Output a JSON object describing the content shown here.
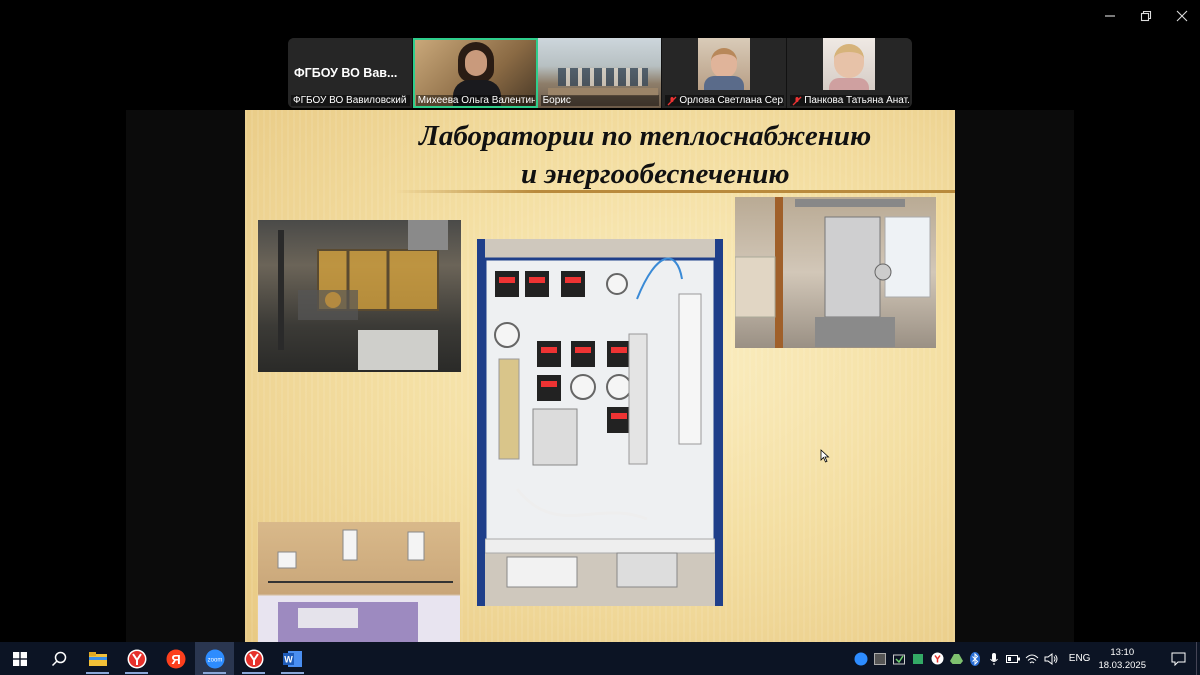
{
  "participants": [
    {
      "big_name": "ФГБОУ ВО Вав...",
      "label": "ФГБОУ ВО Вавиловский ...",
      "muted": false,
      "active": false
    },
    {
      "label": "Михеева Ольга Валентин...",
      "muted": false,
      "active": true
    },
    {
      "label": "Борис",
      "muted": false,
      "active": false
    },
    {
      "label": "Орлова Светлана Сер...",
      "muted": true,
      "active": false
    },
    {
      "label": "Панкова Татьяна Анат...",
      "muted": true,
      "active": false
    }
  ],
  "slide": {
    "title_line1": "Лаборатории по теплоснабжению",
    "title_line2": "и энергообеспечению",
    "photos": [
      {
        "description_icon": "laboratory-room-photo"
      },
      {
        "description_icon": "test-stand-photo"
      },
      {
        "description_icon": "heat-equipment-photo"
      },
      {
        "description_icon": "radiators-photo"
      }
    ]
  },
  "taskbar": {
    "apps": [
      "windows-start-icon",
      "search-icon",
      "file-explorer-icon",
      "yandex-browser-icon",
      "yandex-icon",
      "zoom-icon",
      "yandex-browser-icon",
      "word-icon"
    ],
    "zoom_label": "zoom",
    "word_label": "W",
    "language": "ENG",
    "time": "13:10",
    "date": "18.03.2025"
  }
}
